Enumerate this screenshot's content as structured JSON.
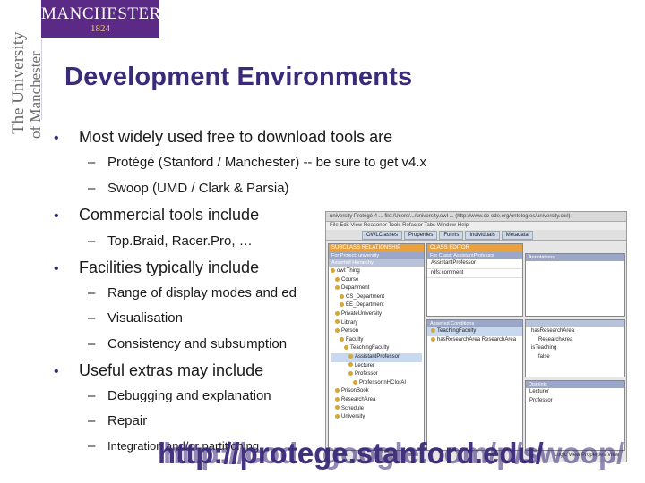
{
  "branding": {
    "logo_name": "MANCHESTER",
    "logo_year": "1824",
    "vertical_line1": "The University",
    "vertical_line2": "of Manchester"
  },
  "slide": {
    "title": "Development Environments",
    "bullets": [
      {
        "text": "Most widely used free to download tools are",
        "subs": [
          "Protégé (Stanford / Manchester) -- be sure to get v4.x",
          "Swoop (UMD / Clark & Parsia)"
        ]
      },
      {
        "text": "Commercial tools include",
        "subs": [
          "Top.Braid, Racer.Pro, …"
        ]
      },
      {
        "text": "Facilities typically include",
        "subs": [
          "Range of display modes and ed",
          "Visualisation",
          "Consistency and subsumption"
        ]
      },
      {
        "text": "Useful extras may include",
        "subs": [
          "Debugging and explanation",
          "Repair",
          "Integration and/or partitioning"
        ]
      }
    ],
    "url_a": "http://protege.stanford.edu/",
    "url_b": "http://code.google.com/p/swoop/"
  },
  "embedded": {
    "titlebar": "university  Protégé 4 ... file:/Users/.../university.owl ... (http://www.co-ode.org/ontologies/university.owl)",
    "menu": "File  Edit  View  Reasoner  Tools  Refactor  Tabs  Window  Help",
    "tabs": [
      "OWLClasses",
      "Properties",
      "Forms",
      "Individuals",
      "Metadata"
    ],
    "left_header": "SUBCLASS RELATIONSHIP",
    "left_sub": "For Project: university",
    "left_sub2": "Asserted Hierarchy",
    "tree": [
      "owl:Thing",
      "Course",
      "Department",
      "CS_Department",
      "EE_Department",
      "PrivateUniversity",
      "Library",
      "Person",
      "Faculty",
      "TeachingFaculty",
      "AssistantProfessor",
      "Lecturer",
      "Professor",
      "ProfessorInHCIorAI",
      "PrisonBook",
      "ResearchArea",
      "Schedule",
      "University"
    ],
    "mid_header": "CLASS EDITOR",
    "mid_sub": "For Class: AssistantProfessor",
    "mid_rows": [
      "AssistantProfessor",
      "rdfs:comment"
    ],
    "annot": "Annotations",
    "asserted": "Asserted Conditions",
    "cond": [
      "TeachingFaculty",
      "hasResearchArea ResearchArea"
    ],
    "props": [
      "hasResearchArea",
      "ResearchArea",
      "isTeaching",
      "false"
    ],
    "disjoints": "Disjoints",
    "disj": [
      "Lecturer",
      "Professor"
    ],
    "footer": "Logic View   Properties View"
  }
}
